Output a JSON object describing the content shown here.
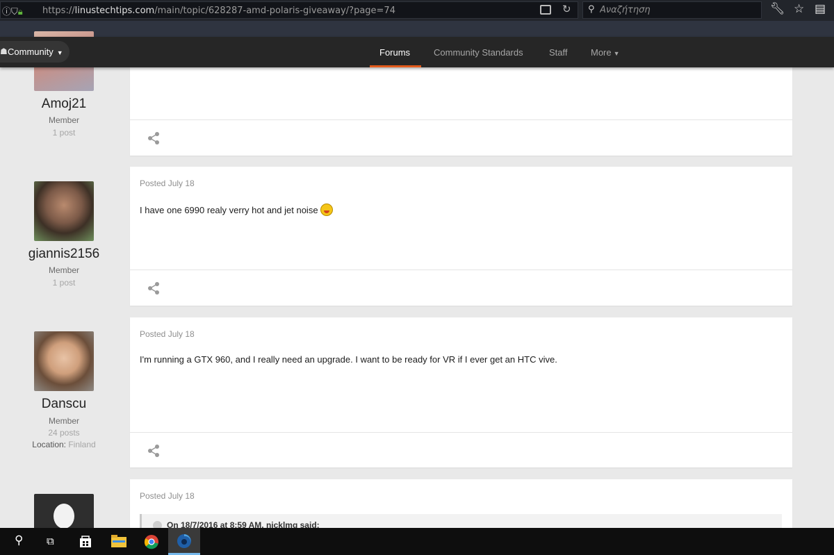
{
  "browser": {
    "url_prefix": "https://",
    "url_host": "linustechtips.com",
    "url_path": "/main/topic/628287-amd-polaris-giveaway/?page=74",
    "search_placeholder": "Αναζήτηση",
    "icons": [
      "info-icon",
      "shield-icon",
      "lock-icon",
      "reader-view-icon",
      "reload-icon",
      "search-icon",
      "wrench-icon",
      "star-icon",
      "clipboard-icon"
    ]
  },
  "site_nav": {
    "community_label": "Community",
    "items": [
      {
        "label": "Forums",
        "active": true
      },
      {
        "label": "Community Standards",
        "active": false
      },
      {
        "label": "Staff",
        "active": false
      },
      {
        "label": "More",
        "active": false
      }
    ],
    "accent_color": "#e35b1c"
  },
  "posts": [
    {
      "author": "Amoj21",
      "role": "Member",
      "post_count": "1 post",
      "date": "",
      "body": ""
    },
    {
      "author": "giannis2156",
      "role": "Member",
      "post_count": "1 post",
      "date": "Posted July 18",
      "body": "I have one 6990 realy verry hot and jet noise"
    },
    {
      "author": "Danscu",
      "role": "Member",
      "post_count": "24 posts",
      "location_label": "Location:",
      "location": "Finland",
      "date": "Posted July 18",
      "body": "I'm running a GTX 960, and I really need an upgrade. I want to be ready for VR if I ever get an HTC vive."
    },
    {
      "author": "",
      "date": "Posted July 18",
      "quote_header": "On 18/7/2016 at 8:59 AM, nicklmg said:"
    }
  ],
  "taskbar": {
    "icons": [
      "windows-search-icon",
      "task-view-icon",
      "store-icon",
      "file-explorer-icon",
      "chrome-icon",
      "firefox-icon"
    ]
  }
}
